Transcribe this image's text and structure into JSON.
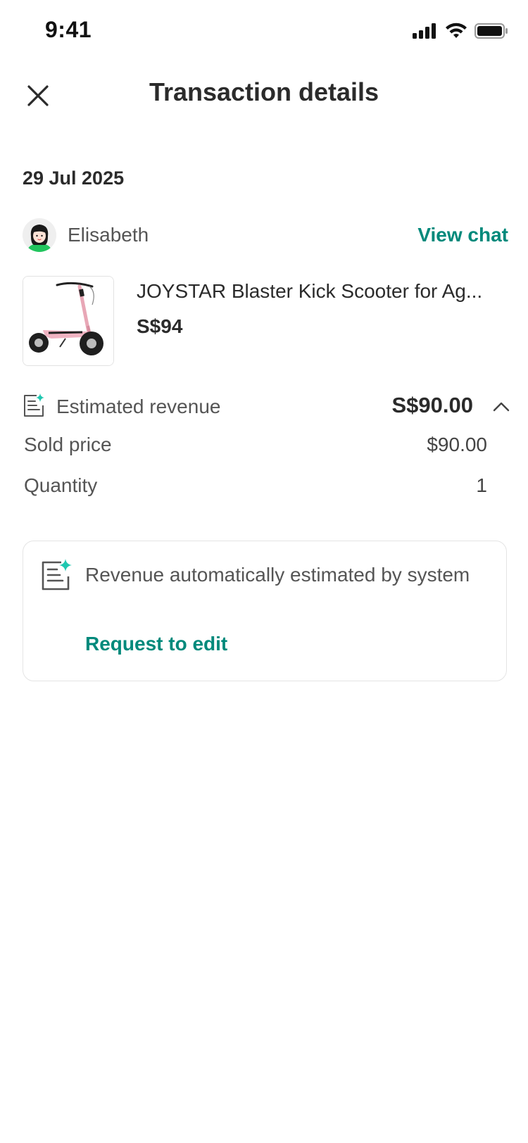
{
  "status_bar": {
    "time": "9:41"
  },
  "header": {
    "title": "Transaction details"
  },
  "transaction": {
    "date": "29 Jul 2025",
    "buyer_name": "Elisabeth",
    "view_chat_label": "View chat",
    "listing_title": "JOYSTAR Blaster Kick Scooter for Ag...",
    "listing_price": "S$94"
  },
  "revenue": {
    "label": "Estimated revenue",
    "amount": "S$90.00",
    "rows": [
      {
        "label": "Sold price",
        "value": "$90.00"
      },
      {
        "label": "Quantity",
        "value": "1"
      }
    ]
  },
  "info": {
    "text": "Revenue automatically estimated by system",
    "action_label": "Request to edit"
  },
  "colors": {
    "accent": "#00897b",
    "sparkle": "#1fc7b0",
    "text": "#2b2b2b",
    "muted": "#555555"
  }
}
